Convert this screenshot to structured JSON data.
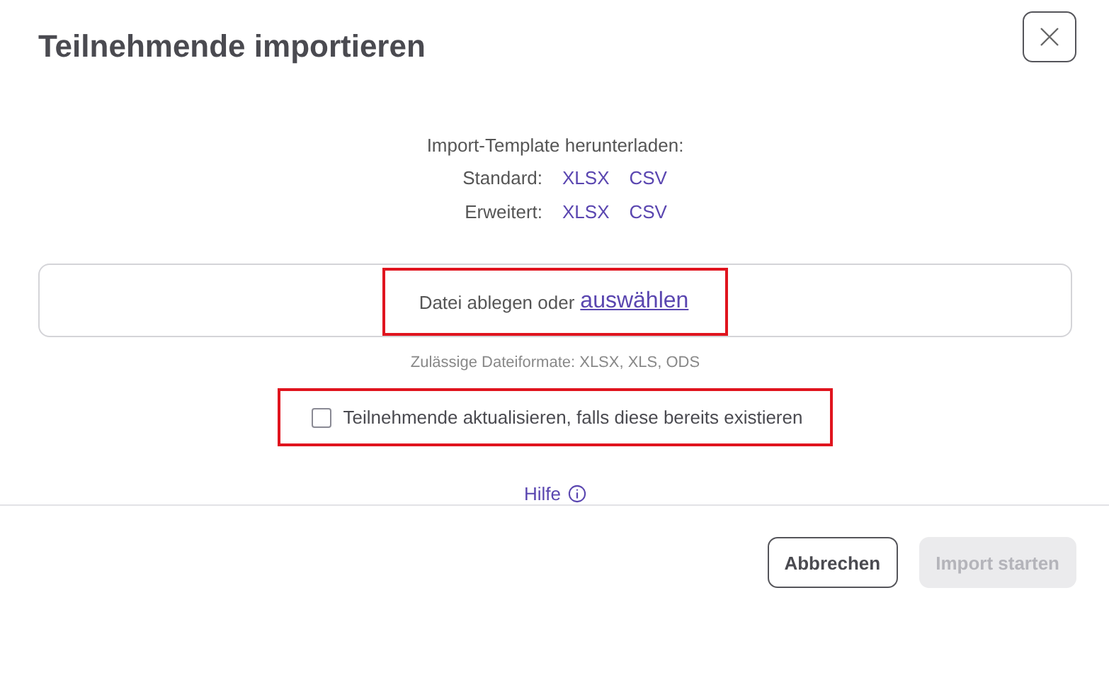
{
  "dialog": {
    "title": "Teilnehmende importieren"
  },
  "templates": {
    "heading": "Import-Template herunterladen:",
    "rows": [
      {
        "label": "Standard:",
        "links": [
          "XLSX",
          "CSV"
        ]
      },
      {
        "label": "Erweitert:",
        "links": [
          "XLSX",
          "CSV"
        ]
      }
    ]
  },
  "dropzone": {
    "prompt": "Datei ablegen oder",
    "link": "auswählen",
    "highlighted": true
  },
  "formats_hint": "Zulässige Dateiformate: XLSX, XLS, ODS",
  "update_option": {
    "label": "Teilnehmende aktualisieren, falls diese bereits existieren",
    "checked": false,
    "highlighted": true
  },
  "help_link": "Hilfe",
  "buttons": [
    {
      "label": "Abbrechen",
      "disabled": false
    },
    {
      "label": "Import starten",
      "disabled": true
    }
  ]
}
